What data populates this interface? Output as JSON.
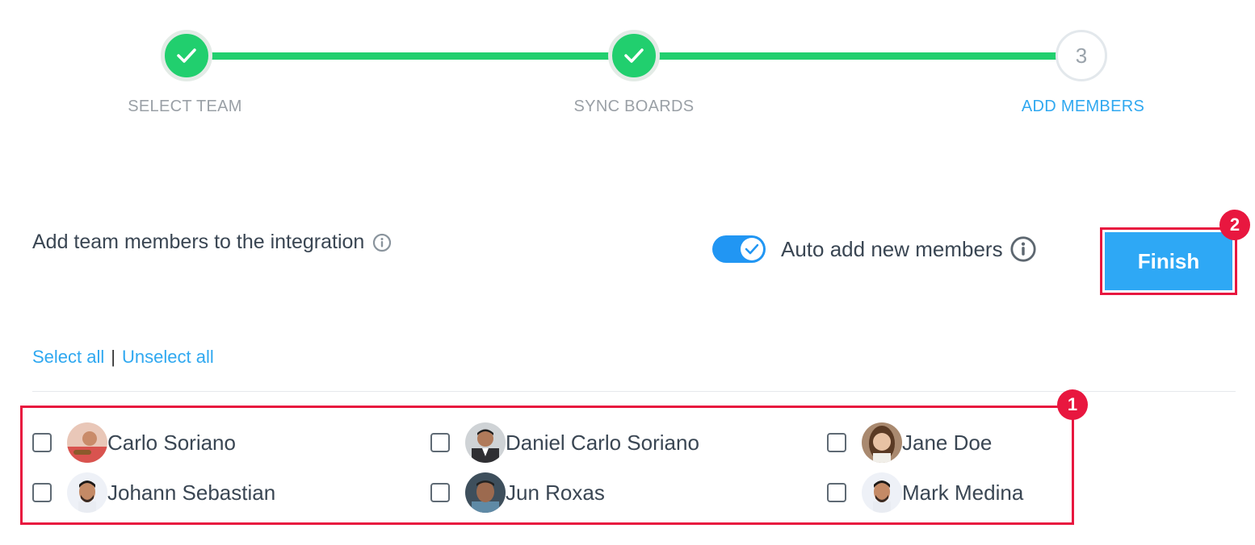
{
  "stepper": {
    "steps": [
      {
        "label": "SELECT TEAM",
        "status": "done"
      },
      {
        "label": "SYNC BOARDS",
        "status": "done"
      },
      {
        "label": "ADD MEMBERS",
        "status": "active",
        "number": "3"
      }
    ],
    "colors": {
      "done": "#21cf6e",
      "active": "#2fa8f0"
    }
  },
  "header": {
    "title": "Add team members to the integration",
    "auto_add_label": "Auto add new members",
    "auto_add_enabled": true,
    "finish_label": "Finish"
  },
  "annotations": {
    "members_badge": "1",
    "finish_badge": "2",
    "color": "#e8173f"
  },
  "selection": {
    "select_all": "Select all",
    "separator": "|",
    "unselect_all": "Unselect all"
  },
  "members": [
    {
      "name": "Carlo Soriano",
      "checked": false
    },
    {
      "name": "Daniel Carlo Soriano",
      "checked": false
    },
    {
      "name": "Jane Doe",
      "checked": false
    },
    {
      "name": "Johann Sebastian",
      "checked": false
    },
    {
      "name": "Jun Roxas",
      "checked": false
    },
    {
      "name": "Mark Medina",
      "checked": false
    }
  ]
}
